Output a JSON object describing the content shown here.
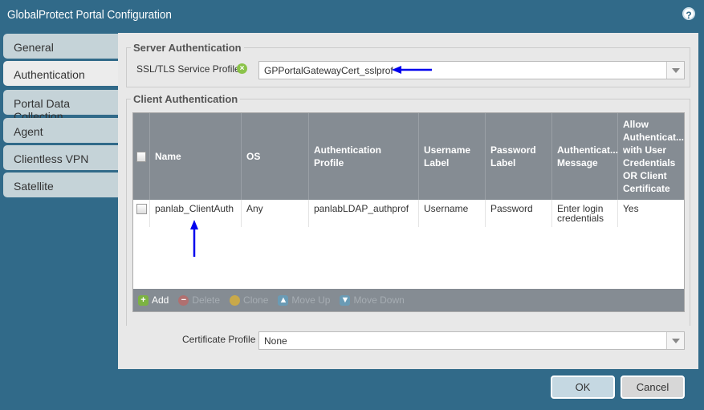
{
  "window": {
    "title": "GlobalProtect Portal Configuration",
    "help_icon": "help-icon"
  },
  "tabs": [
    {
      "label": "General"
    },
    {
      "label": "Authentication",
      "selected": true
    },
    {
      "label": "Portal Data Collection"
    },
    {
      "label": "Agent"
    },
    {
      "label": "Clientless VPN"
    },
    {
      "label": "Satellite"
    }
  ],
  "server_auth": {
    "legend": "Server Authentication",
    "ssl_label": "SSL/TLS Service Profile",
    "ssl_value": "GPPortalGatewayCert_sslprof"
  },
  "client_auth": {
    "legend": "Client Authentication",
    "columns": [
      "Name",
      "OS",
      "Authentication Profile",
      "Username Label",
      "Password Label",
      "Authenticat... Message",
      "Allow Authenticat... with User Credentials OR Client Certificate"
    ],
    "rows": [
      [
        "panlab_ClientAuth",
        "Any",
        "panlabLDAP_authprof",
        "Username",
        "Password",
        "Enter login credentials",
        "Yes"
      ]
    ],
    "toolbar": [
      {
        "label": "Add",
        "enabled": true,
        "icon": "plus-icon"
      },
      {
        "label": "Delete",
        "enabled": false,
        "icon": "minus-icon"
      },
      {
        "label": "Clone",
        "enabled": false,
        "icon": "clone-icon"
      },
      {
        "label": "Move Up",
        "enabled": false,
        "icon": "arrow-up-icon"
      },
      {
        "label": "Move Down",
        "enabled": false,
        "icon": "arrow-down-icon"
      }
    ]
  },
  "cert_profile": {
    "label": "Certificate Profile",
    "value": "None"
  },
  "buttons": {
    "ok": "OK",
    "cancel": "Cancel"
  },
  "colors": {
    "titlebar": "#316a89",
    "tab": "#c5d3d8",
    "header": "#858c93",
    "annotation_arrow": "#0000ee"
  }
}
